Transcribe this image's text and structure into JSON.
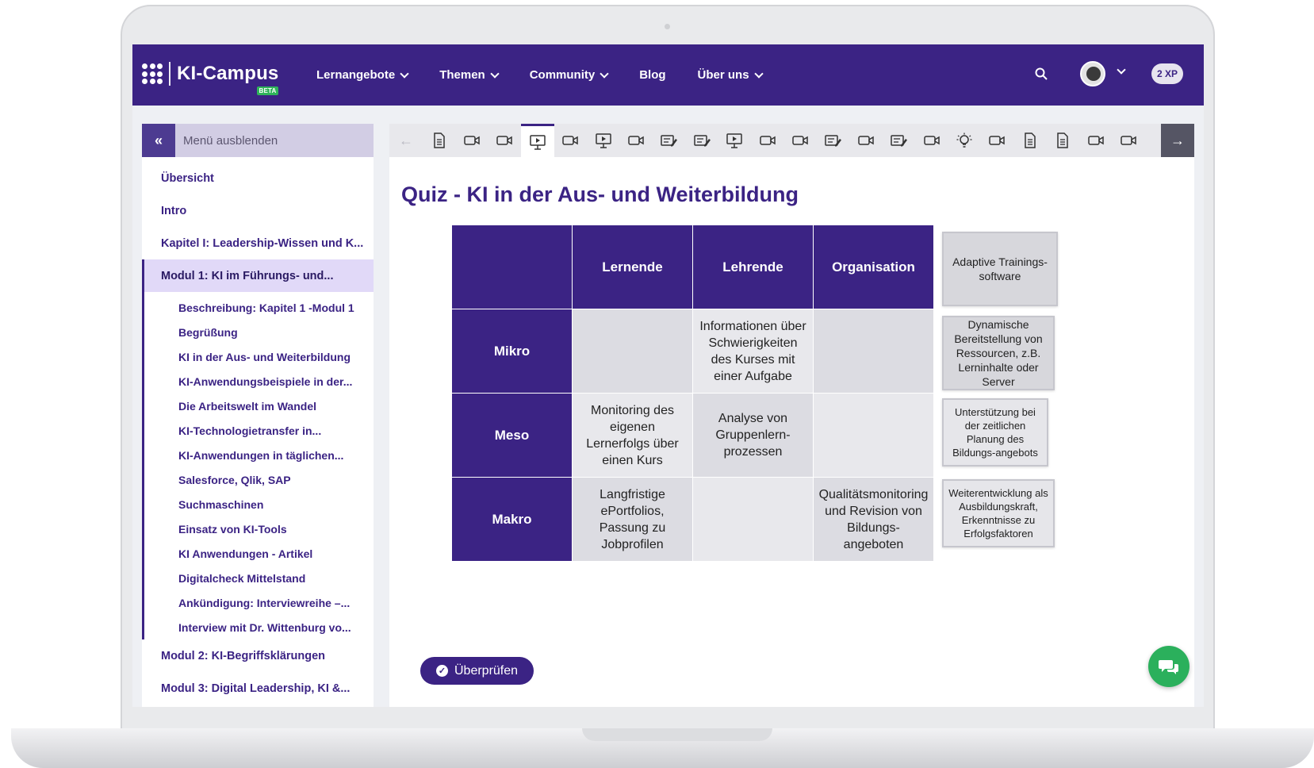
{
  "header": {
    "logo_text": "KI-Campus",
    "beta": "BETA",
    "nav": [
      {
        "label": "Lernangebote",
        "dropdown": true
      },
      {
        "label": "Themen",
        "dropdown": true
      },
      {
        "label": "Community",
        "dropdown": true
      },
      {
        "label": "Blog",
        "dropdown": false
      },
      {
        "label": "Über uns",
        "dropdown": true
      }
    ],
    "xp": "2 XP"
  },
  "sidebar": {
    "toggle_label": "Menü ausblenden",
    "items": [
      {
        "label": "Übersicht"
      },
      {
        "label": "Intro"
      },
      {
        "label": "Kapitel I: Leadership-Wissen und K..."
      },
      {
        "label": "Modul 1: KI im Führungs- und..."
      }
    ],
    "sub_items": [
      "Beschreibung: Kapitel 1 -Modul 1",
      "Begrüßung",
      "KI in der Aus- und Weiterbildung",
      "KI-Anwendungsbeispiele in der...",
      "Die Arbeitswelt im Wandel",
      "KI-Technologietransfer in...",
      "KI-Anwendungen in täglichen...",
      "Salesforce, Qlik, SAP",
      "Suchmaschinen",
      "Einsatz von KI-Tools",
      "KI Anwendungen - Artikel",
      "Digitalcheck Mittelstand",
      "Ankündigung: Interviewreihe –...",
      "Interview mit Dr. Wittenburg vo..."
    ],
    "bottom_items": [
      "Modul 2: KI-Begriffsklärungen",
      "Modul 3: Digital Leadership, KI &..."
    ]
  },
  "toolbar": {
    "icons": [
      "document-icon",
      "video-icon",
      "video-icon",
      "presentation-icon",
      "video-icon",
      "presentation-icon",
      "video-icon",
      "quiz-icon",
      "quiz-icon",
      "presentation-icon",
      "video-icon",
      "video-icon",
      "quiz-icon",
      "video-icon",
      "quiz-icon",
      "video-icon",
      "idea-icon",
      "video-icon",
      "document-icon",
      "document-icon",
      "video-icon",
      "video-icon"
    ],
    "active_index": 3
  },
  "main": {
    "title": "Quiz - KI in der Aus- und Weiterbildung",
    "table": {
      "columns": [
        "Lernende",
        "Lehrende",
        "Organisation"
      ],
      "rows": [
        {
          "label": "Mikro",
          "cells": [
            "",
            "Informationen über Schwierigkeiten des Kurses mit einer Aufgabe",
            ""
          ]
        },
        {
          "label": "Meso",
          "cells": [
            "Monitoring des eigenen Lernerfolgs über einen Kurs",
            "Analyse von Gruppenlern-prozessen",
            ""
          ]
        },
        {
          "label": "Makro",
          "cells": [
            "Langfristige ePortfolios, Passung zu Jobprofilen",
            "",
            "Qualitätsmonitoring und Revision von Bildungs-angeboten"
          ]
        }
      ]
    },
    "answers": [
      "Adaptive Trainings-software",
      "Dynamische Bereitstellung von Ressourcen, z.B. Lerninhalte oder Server",
      "Unterstützung bei der zeitlichen Planung des Bildungs-angebots",
      "Weiterentwicklung als Ausbildungskraft, Erkenntnisse zu Erfolgsfaktoren"
    ],
    "check_button": "Überprüfen"
  },
  "colors": {
    "primary": "#3b2384",
    "active_item": "#e1d9f8",
    "chat": "#2bb05c"
  }
}
